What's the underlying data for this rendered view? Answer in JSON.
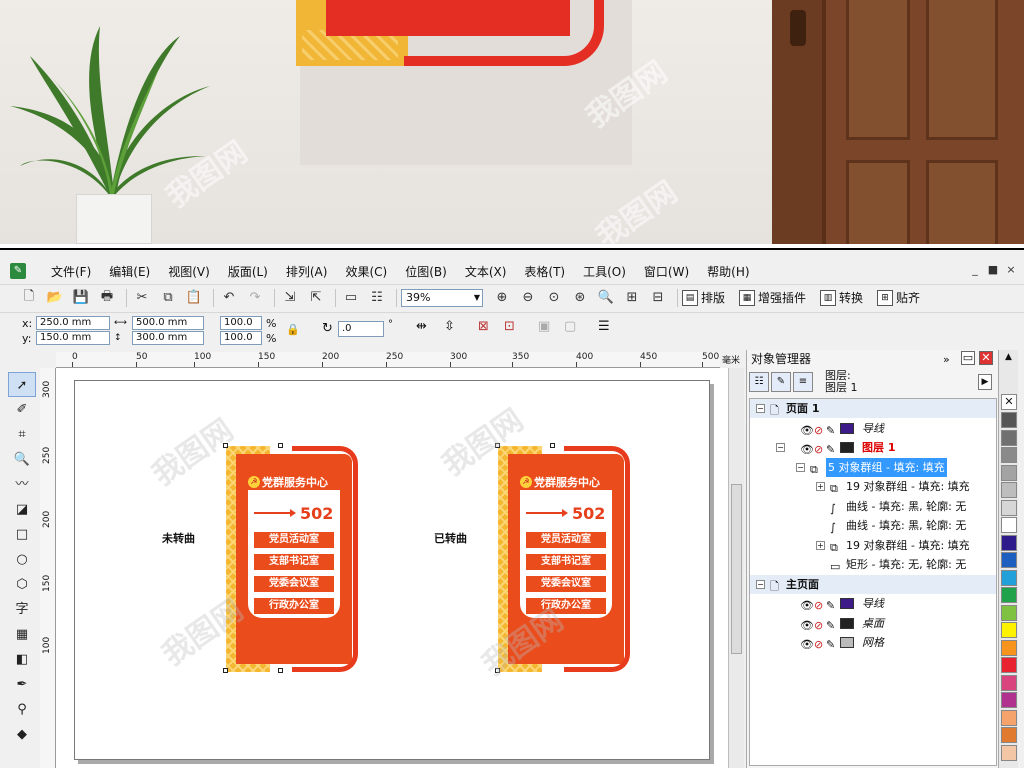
{
  "menu": [
    "文件(F)",
    "编辑(E)",
    "视图(V)",
    "版面(L)",
    "排列(A)",
    "效果(C)",
    "位图(B)",
    "文本(X)",
    "表格(T)",
    "工具(O)",
    "窗口(W)",
    "帮助(H)"
  ],
  "window_controls": [
    "_",
    "■",
    "×"
  ],
  "toolbar": {
    "zoom": "39%",
    "paiban": "排版",
    "plugin": "增强插件",
    "convert": "转换",
    "paste": "贴齐"
  },
  "props": {
    "x": "250.0 mm",
    "y": "150.0 mm",
    "w": "500.0 mm",
    "h": "300.0 mm",
    "sx": "100.0",
    "sy": "100.0",
    "pct": "%",
    "rotation": ".0",
    "deg": "°",
    "x_label": "x:",
    "y_label": "y:"
  },
  "ruler": {
    "h_ticks": [
      "0",
      "50",
      "100",
      "150",
      "200",
      "250",
      "300",
      "350",
      "400",
      "450",
      "500"
    ],
    "v_ticks": [
      "300",
      "250",
      "200",
      "150",
      "100"
    ],
    "unit": "毫米"
  },
  "canvas": {
    "label_left": "未转曲",
    "label_right": "已转曲",
    "sign_title": "党群服务中心",
    "room_number": "502",
    "rooms": [
      "党员活动室",
      "支部书记室",
      "党委会议室",
      "行政办公室"
    ]
  },
  "docker": {
    "title": "对象管理器",
    "layer_label1": "图层:",
    "layer_label2": "图层 1",
    "tree": [
      {
        "label": "页面 1",
        "level": 0,
        "exp": "−"
      },
      {
        "label": "导线",
        "level": 1,
        "color": "#3d1c8a",
        "italic": true
      },
      {
        "label": "图层 1",
        "level": 1,
        "color": "#222222",
        "red": true,
        "exp": "−"
      },
      {
        "label": "5 对象群组 - 填充: 填充",
        "level": 2,
        "selected": true,
        "exp": "−"
      },
      {
        "label": "19 对象群组 - 填充: 填充",
        "level": 3,
        "exp": "+"
      },
      {
        "label": "曲线 - 填充: 黑, 轮廓: 无",
        "level": 3
      },
      {
        "label": "曲线 - 填充: 黑, 轮廓: 无",
        "level": 3
      },
      {
        "label": "19 对象群组 - 填充: 填充",
        "level": 3,
        "exp": "+"
      },
      {
        "label": "矩形 - 填充: 无, 轮廓: 无",
        "level": 3
      },
      {
        "label": "主页面",
        "level": 0,
        "exp": "−"
      },
      {
        "label": "导线",
        "level": 1,
        "color": "#3d1c8a",
        "italic": true
      },
      {
        "label": "桌面",
        "level": 1,
        "color": "#222222",
        "italic": true
      },
      {
        "label": "网格",
        "level": 1,
        "color": "#bbbbbb",
        "italic": true
      }
    ]
  },
  "palette_colors": [
    "#555555",
    "#707070",
    "#8a8a8a",
    "#a3a3a3",
    "#bdbdbd",
    "#d6d6d6",
    "#ffffff",
    "#2e1a8a",
    "#1c5fbf",
    "#21a0d9",
    "#1fa24a",
    "#7fc241",
    "#fff200",
    "#f7941d",
    "#e8232f",
    "#d9447f",
    "#b1318f",
    "#f5a36b",
    "#e07a2e",
    "#f3c7a6"
  ],
  "watermark": "我图网"
}
